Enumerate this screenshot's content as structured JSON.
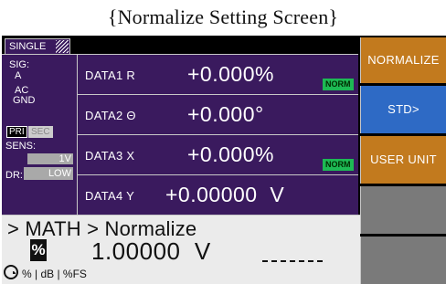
{
  "caption": "{Normalize Setting Screen}",
  "mode_tab": "SINGLE",
  "left_panel": {
    "sig_label": "SIG:",
    "sig_a": "A",
    "sig_ac": "AC",
    "sig_gnd": "GND",
    "pri": "PRI",
    "sec": "SEC",
    "sens_label": "SENS:",
    "sens_value": "1V",
    "dr_label": "DR:",
    "dr_value": "LOW"
  },
  "data_rows": [
    {
      "label": "DATA1  R",
      "value": "+0.000%",
      "badge": "NORM"
    },
    {
      "label": "DATA2  Θ",
      "value": "+0.000°",
      "badge": ""
    },
    {
      "label": "DATA3  X",
      "value": "+0.000%",
      "badge": "NORM"
    },
    {
      "label": "DATA4  Y",
      "value": "+0.00000  V",
      "badge": ""
    }
  ],
  "softkeys": [
    "NORMALIZE",
    "STD>",
    "USER UNIT",
    "",
    ""
  ],
  "math": {
    "breadcrumb": "> MATH > Normalize",
    "unit_icon": "%",
    "value": "1.00000  V",
    "options": "% | dB | %FS"
  },
  "colors": {
    "panel_purple": "#3a1a5e",
    "norm_badge": "#1db954",
    "softkey_orange": "#c27a1e",
    "softkey_blue": "#2e6ac5",
    "softkey_gray": "#7a7a7a"
  }
}
